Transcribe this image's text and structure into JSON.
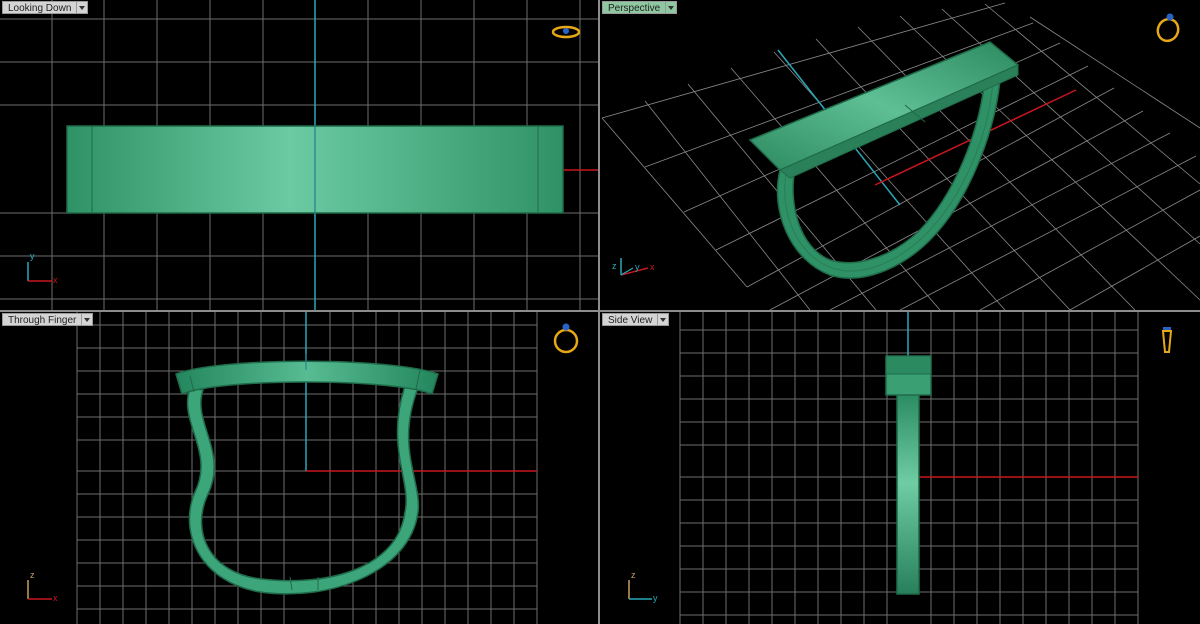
{
  "viewports": {
    "top_left": {
      "label": "Looking Down",
      "active": false,
      "axes": [
        "y",
        "x"
      ]
    },
    "top_right": {
      "label": "Perspective",
      "active": true,
      "axes": [
        "z",
        "y",
        "x"
      ]
    },
    "bottom_left": {
      "label": "Through Finger",
      "active": false,
      "axes": [
        "z",
        "x"
      ]
    },
    "bottom_right": {
      "label": "Side View",
      "active": false,
      "axes": [
        "z",
        "y"
      ]
    }
  },
  "colors": {
    "background": "#000000",
    "grid": "#6e6e6e",
    "model_fill": "#3fa57a",
    "model_edge": "#1f6b4a",
    "axis_x": "#c8161d",
    "axis_y": "#2aa8b8",
    "label_active": "#8fc7a0",
    "nav_icon": "#e6a817"
  },
  "icons": [
    "ring-top-icon",
    "ring-perspective-icon",
    "ring-front-icon",
    "ring-side-icon",
    "dropdown-icon",
    "axis-triad-icon"
  ]
}
